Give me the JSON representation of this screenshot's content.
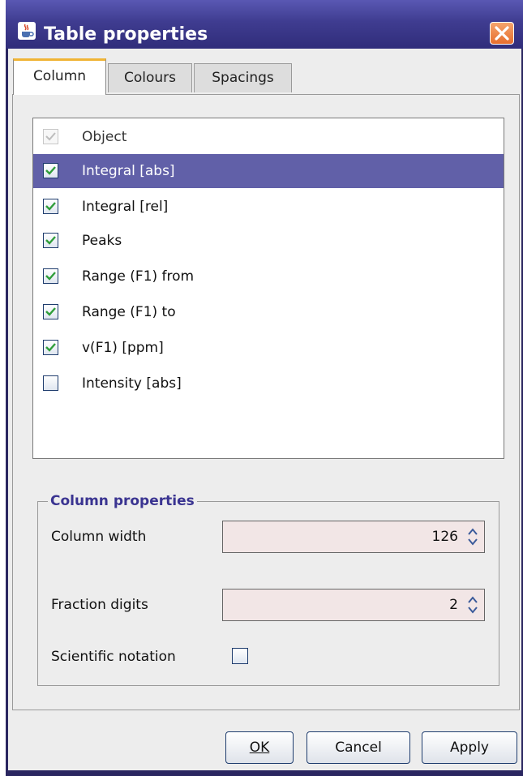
{
  "window": {
    "title": "Table properties",
    "icon": "java-cup-icon",
    "close_icon": "close-icon"
  },
  "tabs": [
    {
      "label": "Column",
      "active": true
    },
    {
      "label": "Colours",
      "active": false
    },
    {
      "label": "Spacings",
      "active": false
    }
  ],
  "columns_list": {
    "items": [
      {
        "label": "Object",
        "checked": true,
        "disabled": true,
        "selected": false
      },
      {
        "label": "Integral [abs]",
        "checked": true,
        "disabled": false,
        "selected": true
      },
      {
        "label": "Integral [rel]",
        "checked": true,
        "disabled": false,
        "selected": false
      },
      {
        "label": "Peaks",
        "checked": true,
        "disabled": false,
        "selected": false
      },
      {
        "label": "Range (F1) from",
        "checked": true,
        "disabled": false,
        "selected": false
      },
      {
        "label": "Range (F1) to",
        "checked": true,
        "disabled": false,
        "selected": false
      },
      {
        "label": "v(F1) [ppm]",
        "checked": true,
        "disabled": false,
        "selected": false
      },
      {
        "label": "Intensity [abs]",
        "checked": false,
        "disabled": false,
        "selected": false
      }
    ]
  },
  "column_properties": {
    "title": "Column properties",
    "column_width_label": "Column width",
    "column_width_value": "126",
    "fraction_digits_label": "Fraction digits",
    "fraction_digits_value": "2",
    "scientific_notation_label": "Scientific notation",
    "scientific_notation_checked": false
  },
  "buttons": {
    "ok": "OK",
    "cancel": "Cancel",
    "apply": "Apply"
  },
  "colors": {
    "title_bar": "#3f3c90",
    "selection": "#6160a8",
    "check_mark": "#2f9e3a",
    "group_title": "#3a3491",
    "spinner_bg": "#f2e6e6"
  }
}
